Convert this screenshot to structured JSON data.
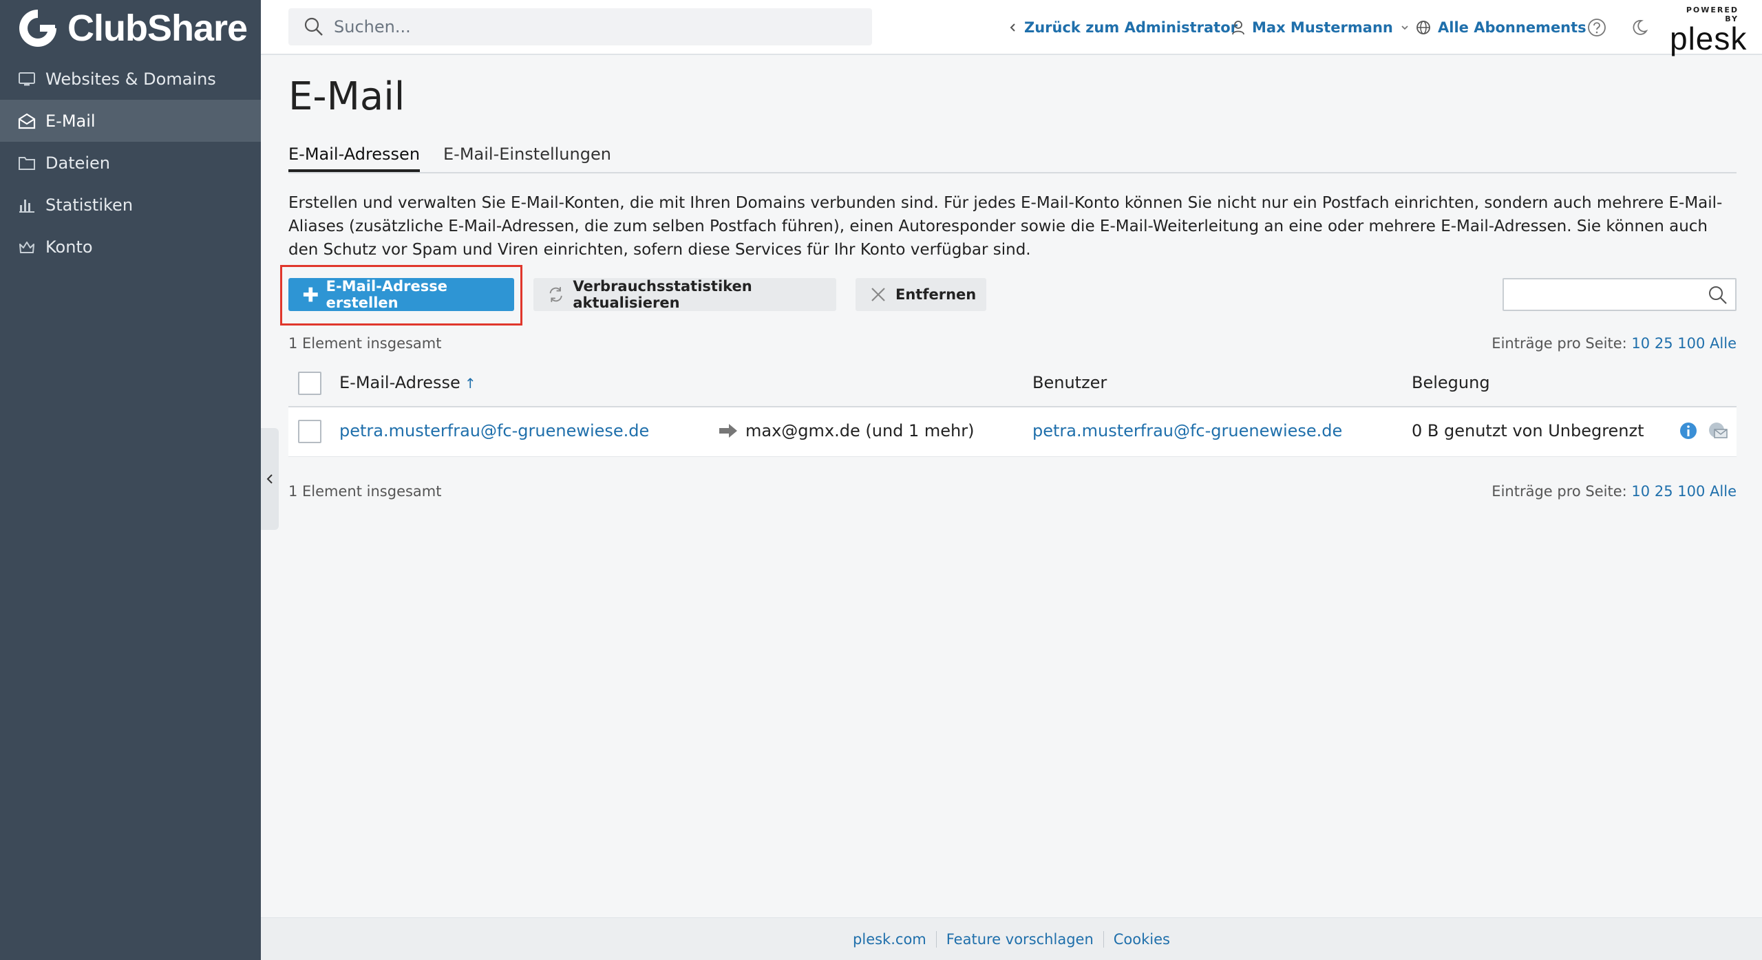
{
  "brand": {
    "name": "ClubShare"
  },
  "sidebar": {
    "items": [
      {
        "label": "Websites & Domains",
        "icon": "monitor-icon",
        "active": false
      },
      {
        "label": "E-Mail",
        "icon": "mail-icon",
        "active": true
      },
      {
        "label": "Dateien",
        "icon": "folder-icon",
        "active": false
      },
      {
        "label": "Statistiken",
        "icon": "bar-chart-icon",
        "active": false
      },
      {
        "label": "Konto",
        "icon": "crown-icon",
        "active": false
      }
    ]
  },
  "topbar": {
    "search_placeholder": "Suchen...",
    "back_label": "Zurück zum Administrator",
    "user_label": "Max Mustermann",
    "subscriptions_label": "Alle Abonnements",
    "powered_by": "POWERED BY",
    "plesk": "plesk"
  },
  "page": {
    "title": "E-Mail",
    "tabs": [
      {
        "label": "E-Mail-Adressen",
        "active": true
      },
      {
        "label": "E-Mail-Einstellungen",
        "active": false
      }
    ],
    "description": "Erstellen und verwalten Sie E-Mail-Konten, die mit Ihren Domains verbunden sind. Für jedes E-Mail-Konto können Sie nicht nur ein Postfach einrichten, sondern auch mehrere E-Mail-Aliases (zusätzliche E-Mail-Adressen, die zum selben Postfach führen), einen Autoresponder sowie die E-Mail-Weiterleitung an eine oder mehrere E-Mail-Adressen. Sie können auch den Schutz vor Spam und Viren einrichten, sofern diese Services für Ihr Konto verfügbar sind."
  },
  "toolbar": {
    "create_label": "E-Mail-Adresse erstellen",
    "refresh_label": "Verbrauchsstatistiken aktualisieren",
    "remove_label": "Entfernen"
  },
  "list": {
    "total_label": "1 Element insgesamt",
    "per_page_label": "Einträge pro Seite:",
    "per_page_options": [
      "10",
      "25",
      "100",
      "Alle"
    ],
    "columns": {
      "email": "E-Mail-Adresse",
      "sort_arrow": "↑",
      "user": "Benutzer",
      "usage": "Belegung"
    },
    "rows": [
      {
        "email": "petra.musterfrau@fc-gruenewiese.de",
        "forward": "max@gmx.de (und 1 mehr)",
        "user": "petra.musterfrau@fc-gruenewiese.de",
        "usage": "0 B genutzt von Unbegrenzt"
      }
    ]
  },
  "footer": {
    "links": [
      "plesk.com",
      "Feature vorschlagen",
      "Cookies"
    ]
  },
  "colors": {
    "sidebar": "#3d4a58",
    "primary": "#2e95d4",
    "link": "#1f6fab",
    "highlight": "#e0372c"
  }
}
